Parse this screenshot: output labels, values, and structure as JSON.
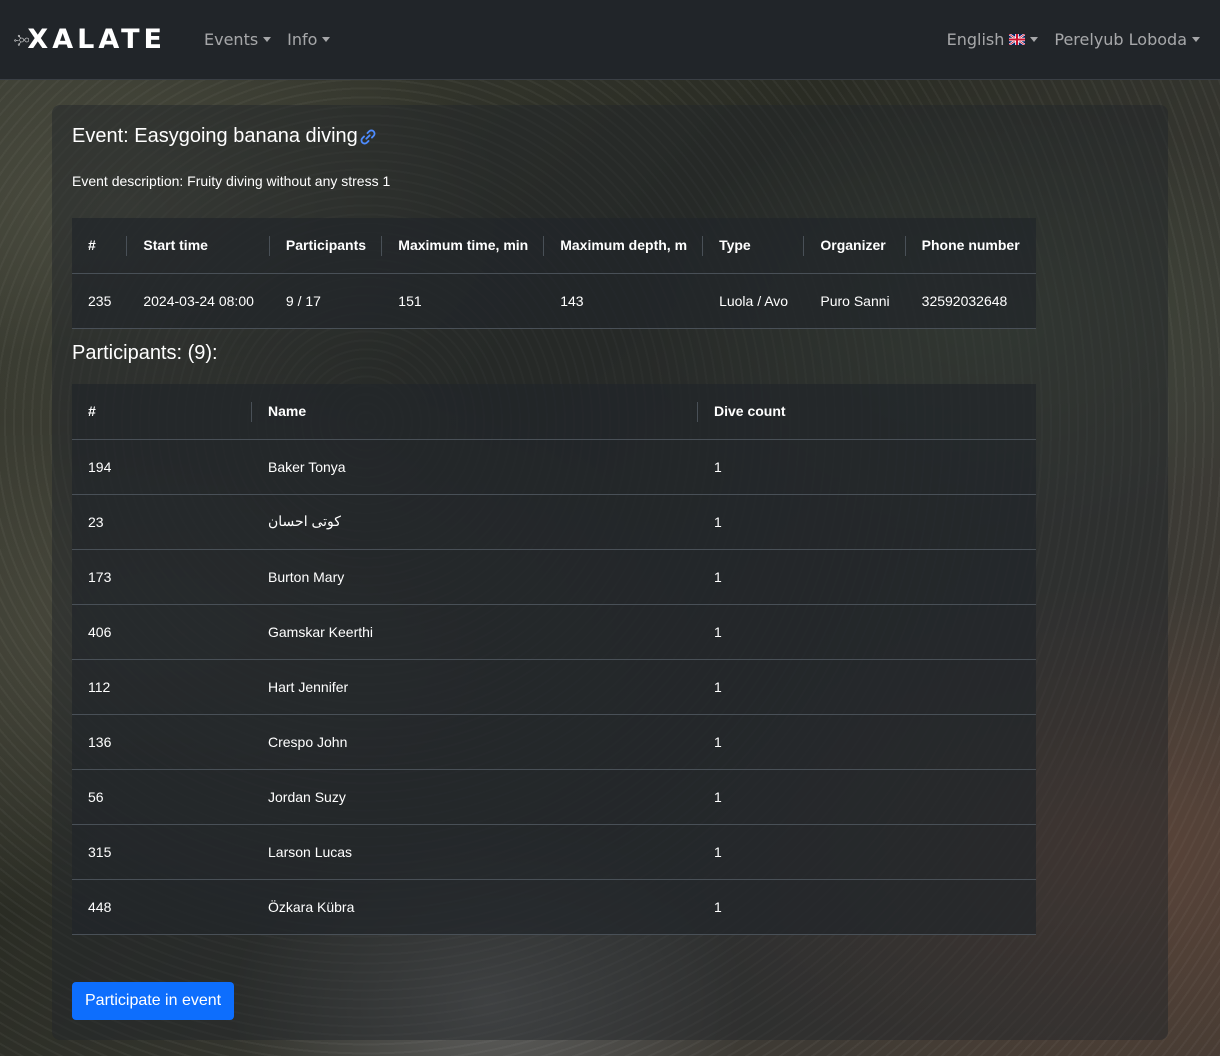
{
  "navbar": {
    "brand": "XALATE",
    "events_label": "Events",
    "info_label": "Info",
    "language_label": "English",
    "user_label": "Perelyub Loboda"
  },
  "event": {
    "title": "Event: Easygoing banana diving",
    "description": "Event description: Fruity diving without any stress 1",
    "table": {
      "headers": [
        "#",
        "Start time",
        "Participants",
        "Maximum time, min",
        "Maximum depth, m",
        "Type",
        "Organizer",
        "Phone number"
      ],
      "row": [
        "235",
        "2024-03-24 08:00",
        "9 / 17",
        "151",
        "143",
        "Luola / Avo",
        "Puro Sanni",
        "32592032648"
      ]
    }
  },
  "participants": {
    "title": "Participants: (9):",
    "headers": [
      "#",
      "Name",
      "Dive count"
    ],
    "rows": [
      {
        "id": "194",
        "name": "Baker Tonya",
        "dives": "1"
      },
      {
        "id": "23",
        "name": "کوتی احسان",
        "dives": "1"
      },
      {
        "id": "173",
        "name": "Burton Mary",
        "dives": "1"
      },
      {
        "id": "406",
        "name": "Gamskar Keerthi",
        "dives": "1"
      },
      {
        "id": "112",
        "name": "Hart Jennifer",
        "dives": "1"
      },
      {
        "id": "136",
        "name": "Crespo John",
        "dives": "1"
      },
      {
        "id": "56",
        "name": "Jordan Suzy",
        "dives": "1"
      },
      {
        "id": "315",
        "name": "Larson Lucas",
        "dives": "1"
      },
      {
        "id": "448",
        "name": "Özkara Kübra",
        "dives": "1"
      }
    ]
  },
  "actions": {
    "participate_label": "Participate in event"
  },
  "colors": {
    "primary": "#0d6efd",
    "navbar_bg": "#212529",
    "link": "#4d8cff"
  }
}
